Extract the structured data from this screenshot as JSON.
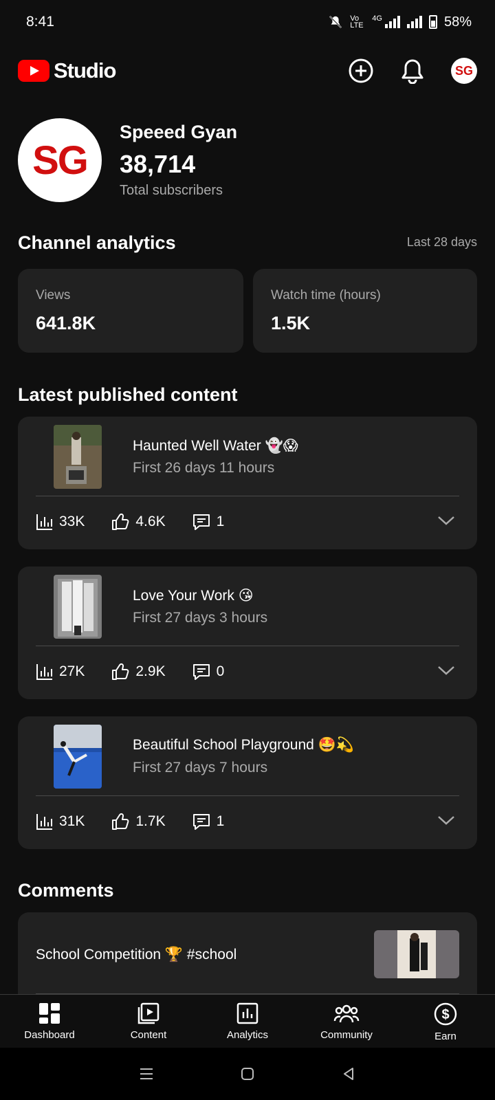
{
  "status_bar": {
    "time": "8:41",
    "battery": "58%",
    "network": "4G",
    "volte": "Vo LTE"
  },
  "app": {
    "logo_text": "Studio"
  },
  "header": {
    "avatar_initials": "SG"
  },
  "channel": {
    "initials": "SG",
    "name": "Speeed Gyan",
    "subscribers": "38,714",
    "subscribers_label": "Total subscribers"
  },
  "analytics": {
    "title": "Channel analytics",
    "period": "Last 28 days",
    "cards": [
      {
        "label": "Views",
        "value": "641.8K"
      },
      {
        "label": "Watch time (hours)",
        "value": "1.5K"
      }
    ]
  },
  "latest": {
    "title": "Latest published content",
    "items": [
      {
        "title": "Haunted Well Water 👻😱",
        "subtitle": "First 26 days 11 hours",
        "views": "33K",
        "likes": "4.6K",
        "comments": "1"
      },
      {
        "title": "Love Your Work 😘",
        "subtitle": "First 27 days 3 hours",
        "views": "27K",
        "likes": "2.9K",
        "comments": "0"
      },
      {
        "title": "Beautiful School Playground 🤩💫",
        "subtitle": "First 27 days 7 hours",
        "views": "31K",
        "likes": "1.7K",
        "comments": "1"
      }
    ]
  },
  "comments": {
    "title": "Comments",
    "item": {
      "title": "School Competition 🏆 #school"
    }
  },
  "nav": {
    "items": [
      {
        "label": "Dashboard",
        "icon": "dashboard-icon"
      },
      {
        "label": "Content",
        "icon": "content-icon"
      },
      {
        "label": "Analytics",
        "icon": "analytics-icon"
      },
      {
        "label": "Community",
        "icon": "community-icon"
      },
      {
        "label": "Earn",
        "icon": "earn-icon"
      }
    ]
  },
  "colors": {
    "background": "#0f0f0f",
    "card": "#212121",
    "brand_red": "#ff0000",
    "muted_text": "#aaaaaa"
  }
}
